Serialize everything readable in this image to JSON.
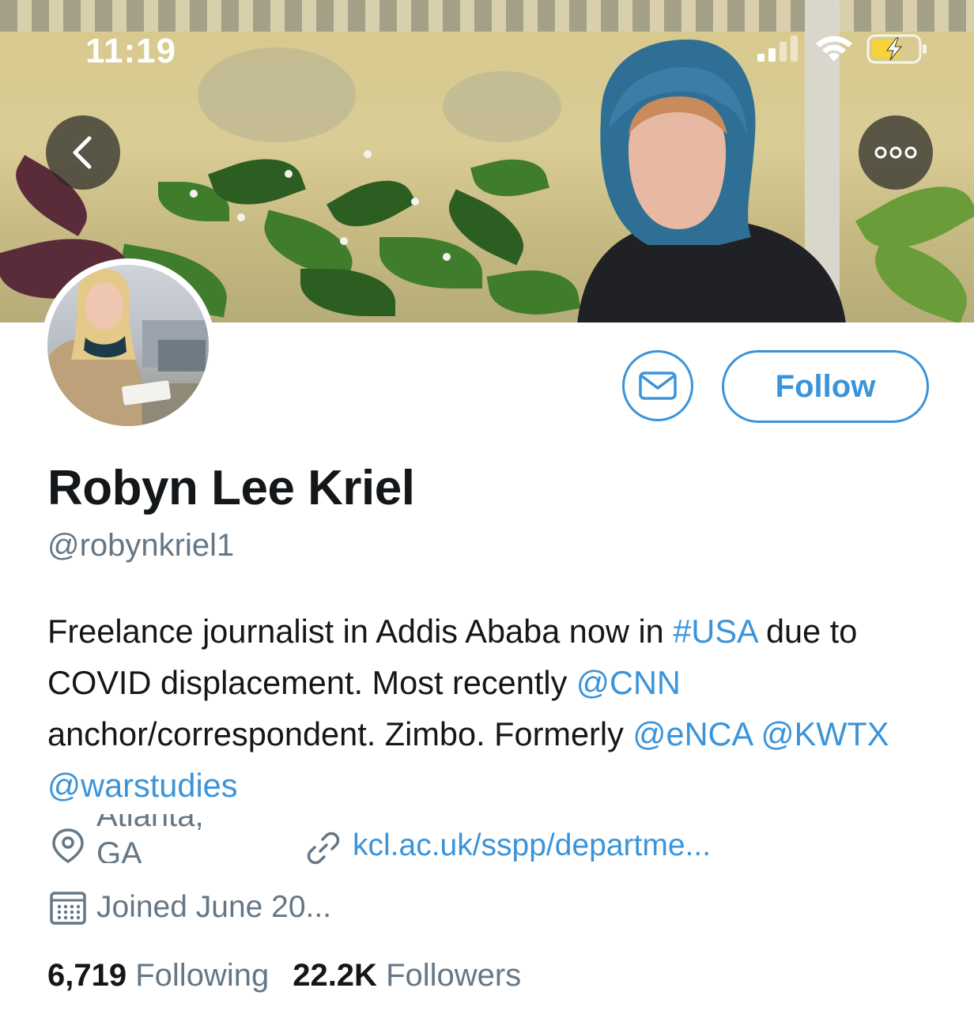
{
  "status_bar": {
    "time": "11:19",
    "icons": [
      "signal-icon",
      "wifi-icon",
      "battery-charging-icon"
    ],
    "battery_color": "#f5d33b"
  },
  "nav": {
    "back_icon": "chevron-left-icon",
    "more_icon": "ellipsis-icon"
  },
  "actions": {
    "message_icon": "mail-icon",
    "follow_label": "Follow"
  },
  "profile": {
    "name": "Robyn Lee Kriel",
    "handle": "@robynkriel1",
    "bio": [
      {
        "text": "Freelance journalist in Addis Ababa now in ",
        "link": false
      },
      {
        "text": "#USA",
        "link": true
      },
      {
        "text": " due to COVID displacement. Most recently ",
        "link": false
      },
      {
        "text": "@CNN",
        "link": true
      },
      {
        "text": " anchor/correspondent. Zimbo. Formerly ",
        "link": false
      },
      {
        "text": "@eNCA",
        "link": true
      },
      {
        "text": " ",
        "link": false
      },
      {
        "text": "@KWTX",
        "link": true
      },
      {
        "text": " ",
        "link": false
      },
      {
        "text": "@warstudies",
        "link": true
      }
    ],
    "location": "Atlanta, GA",
    "website": "kcl.ac.uk/sspp/departme...",
    "joined": "Joined June 20..."
  },
  "stats": {
    "following_count": "6,719",
    "following_label": "Following",
    "followers_count": "22.2K",
    "followers_label": "Followers"
  },
  "colors": {
    "accent": "#3b94d9",
    "text_primary": "#14171a",
    "text_secondary": "#657786"
  }
}
